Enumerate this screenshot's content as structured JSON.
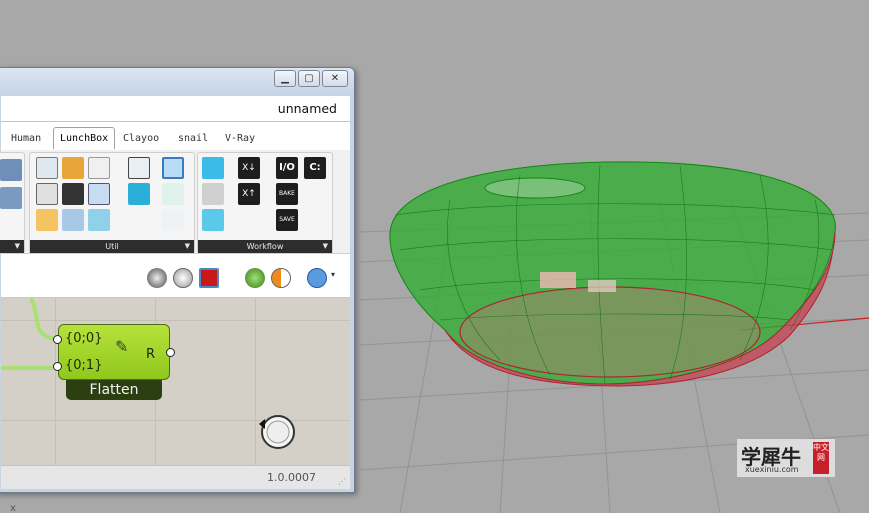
{
  "window": {
    "title_buttons": {
      "minimize": "▁",
      "maximize": "▢",
      "close": "✕"
    },
    "document_title": "unnamed"
  },
  "tabs": [
    {
      "label": "Human",
      "active": false
    },
    {
      "label": "LunchBox",
      "active": true
    },
    {
      "label": "Clayoo",
      "active": false
    },
    {
      "label": "snail",
      "active": false
    },
    {
      "label": "V-Ray",
      "active": false
    }
  ],
  "ribbon": {
    "panels": [
      {
        "label": "",
        "arrow": "▼"
      },
      {
        "label": "Util",
        "arrow": "▼"
      },
      {
        "label": "Workflow",
        "arrow": "▼"
      }
    ],
    "workflow_buttons": {
      "io": "I/O",
      "c": "C:",
      "bake": "BAKE",
      "save": "SAVE"
    }
  },
  "component": {
    "name": "Flatten",
    "inputs": [
      "{0;0}",
      "{0;1}"
    ],
    "output": "R"
  },
  "status": {
    "version": "1.0.0007"
  },
  "watermark": {
    "main": "学犀牛",
    "sub": "xuexiniu.com",
    "stamp": "中文网"
  },
  "viewport": {
    "axis_label": "x",
    "grid_color": "#8f8f8f",
    "shape_fill": "#20b020",
    "shape_edge": "#cc2233"
  }
}
